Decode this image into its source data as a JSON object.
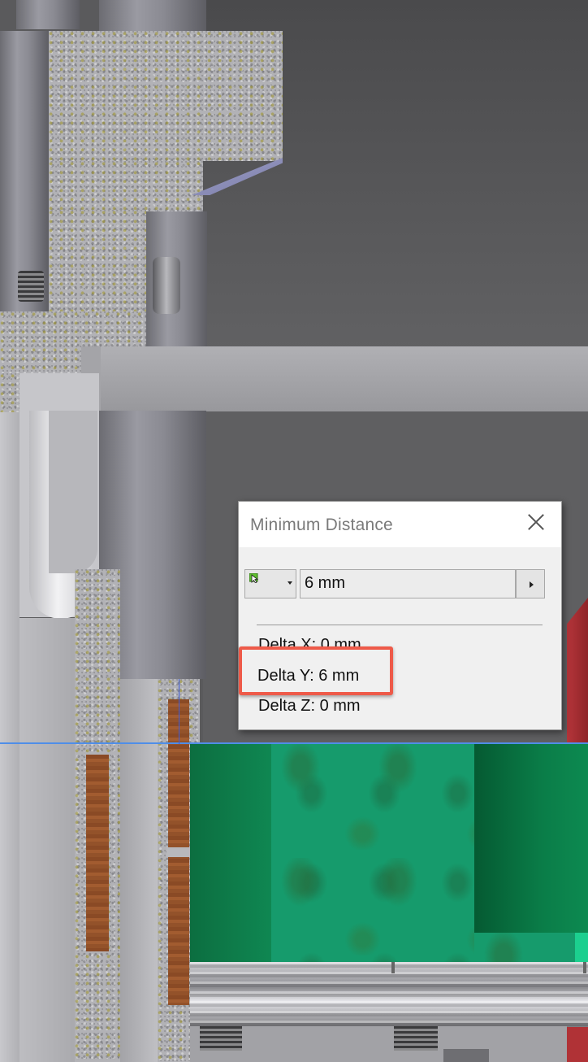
{
  "dialog": {
    "title": "Minimum Distance",
    "distance_value": "6 mm",
    "delta_x": "Delta X: 0 mm",
    "delta_y": "Delta Y: 6 mm",
    "delta_z": "Delta Z: 0 mm",
    "icons": {
      "close": "close-icon",
      "selector": "select-pointer-icon",
      "dropdown": "chevron-down-icon",
      "expand": "chevron-right-icon"
    }
  },
  "colors": {
    "highlight": "#ee5a49",
    "measure_line": "#4f8ee8",
    "dialog_bg": "#f0f0f0"
  }
}
